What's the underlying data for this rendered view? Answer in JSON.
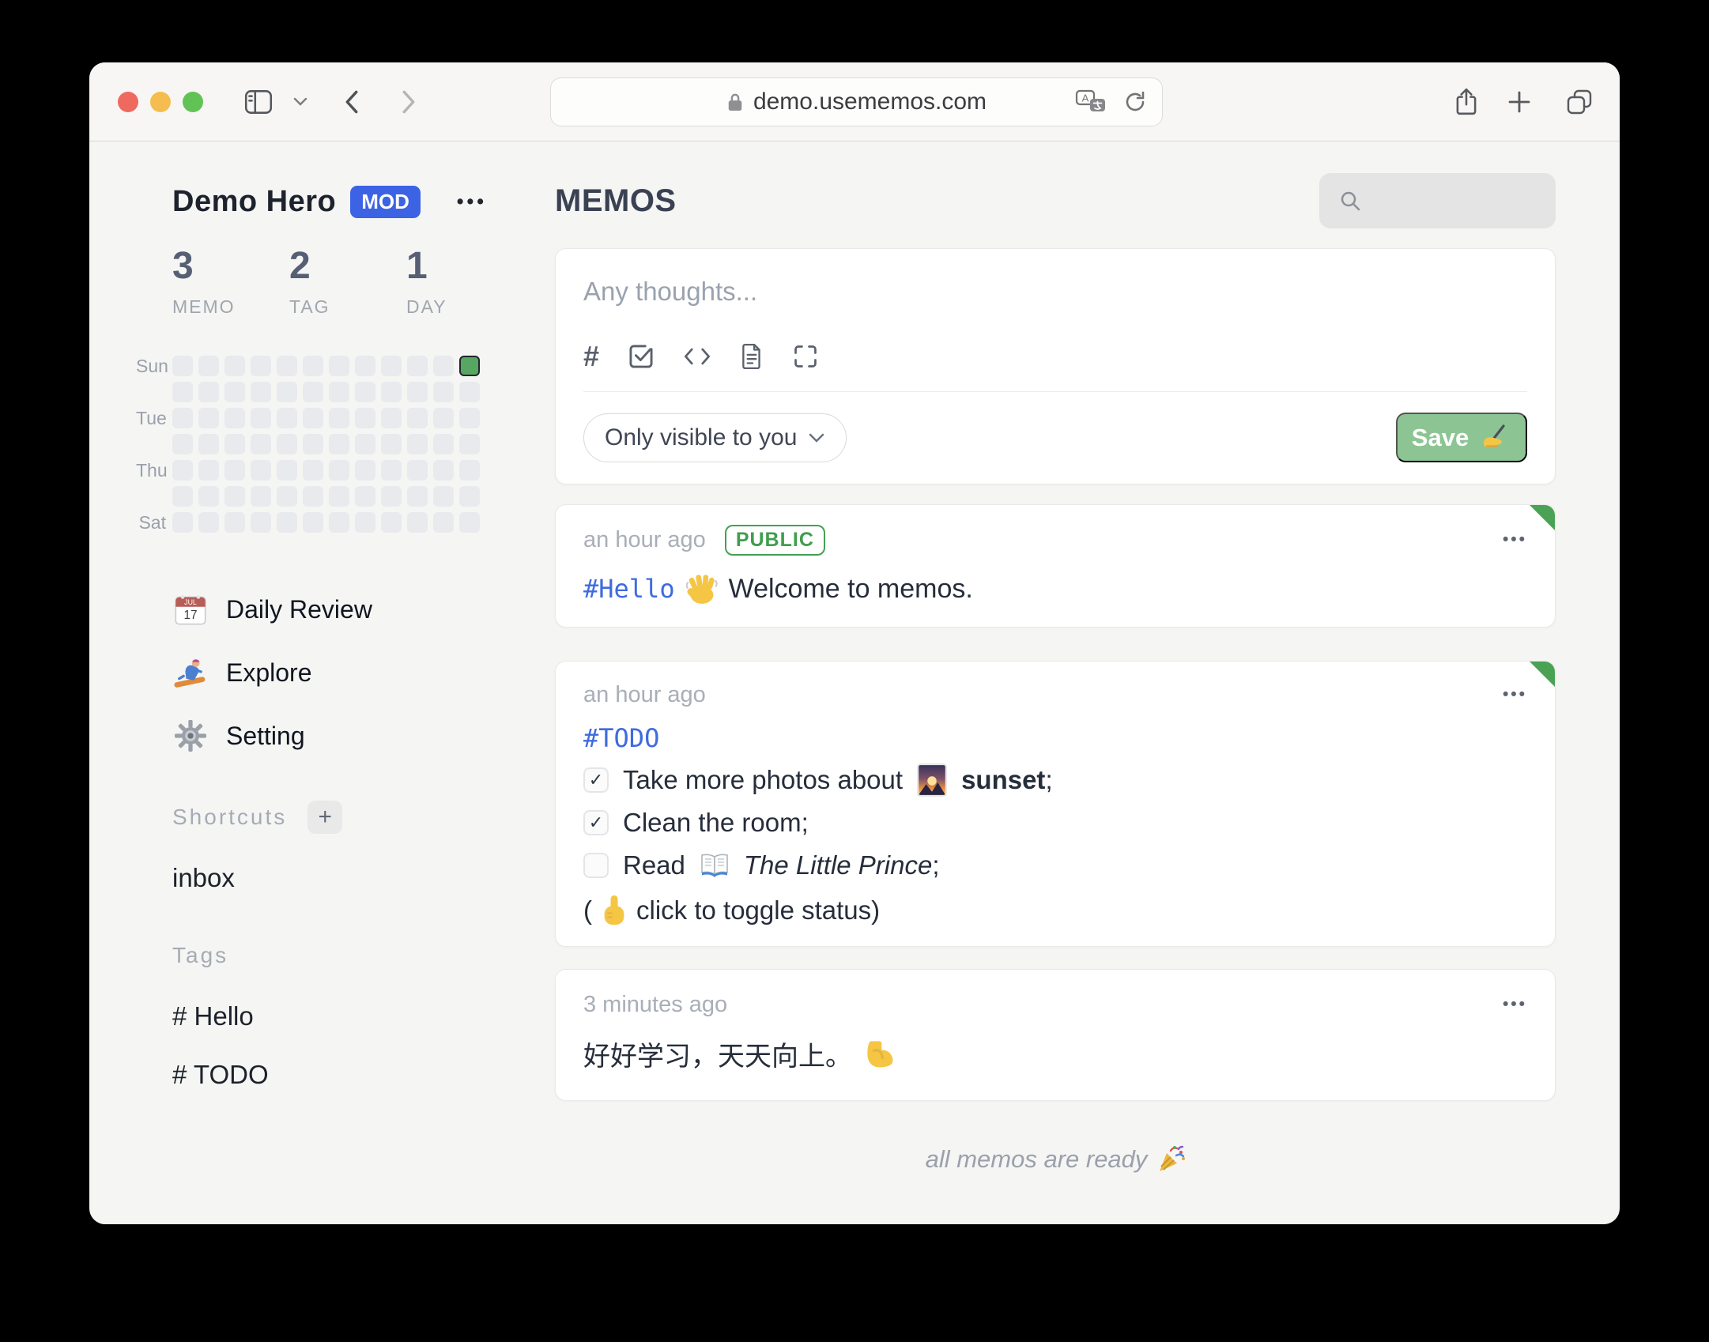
{
  "browser": {
    "url": "demo.usememos.com"
  },
  "sidebar": {
    "user": {
      "name": "Demo Hero",
      "badge": "MOD"
    },
    "menu_dots": "•••",
    "stats": [
      {
        "value": "3",
        "label": "MEMO"
      },
      {
        "value": "2",
        "label": "TAG"
      },
      {
        "value": "1",
        "label": "DAY"
      }
    ],
    "heatmap": {
      "weeks": 12,
      "days": 7,
      "row_labels": [
        "Sun",
        "",
        "Tue",
        "",
        "Thu",
        "",
        "Sat"
      ],
      "active": {
        "week": 12,
        "day": 1
      },
      "cell_color": "#e9eaee",
      "active_color": "#57a763"
    },
    "nav": [
      {
        "icon": "calendar-emoji",
        "label": "Daily Review"
      },
      {
        "icon": "snowboarder-emoji",
        "label": "Explore"
      },
      {
        "icon": "gear-emoji",
        "label": "Setting"
      }
    ],
    "shortcuts": {
      "title": "Shortcuts",
      "add_label": "+",
      "items": [
        "inbox"
      ]
    },
    "tags": {
      "title": "Tags",
      "items": [
        "# Hello",
        "# TODO"
      ]
    }
  },
  "main": {
    "title": "MEMOS",
    "menu_dots": "•••",
    "editor": {
      "placeholder": "Any thoughts...",
      "visibility_label": "Only visible to you",
      "save_label": "Save",
      "save_emoji": "✍️"
    },
    "memos": [
      {
        "time": "an hour ago",
        "visibility_badge": "PUBLIC",
        "tag": "#Hello",
        "emoji": "👋",
        "text": "Welcome to memos."
      },
      {
        "time": "an hour ago",
        "tag": "#TODO",
        "tasks": [
          {
            "checked": true,
            "check_glyph": "✓",
            "before": "Take more photos about",
            "image_emoji": "🌄",
            "bold": "sunset",
            "after": ";"
          },
          {
            "checked": true,
            "check_glyph": "✓",
            "text": "Clean the room;"
          },
          {
            "checked": false,
            "before": "Read",
            "book_emoji": "📖",
            "italic": "The Little Prince",
            "after": ";"
          }
        ],
        "hint": {
          "open": "(",
          "emoji": "👆",
          "text": "click to toggle status)"
        }
      },
      {
        "time": "3 minutes ago",
        "text": "好好学习，天天向上。",
        "emoji": "💪"
      }
    ],
    "footer": {
      "text": "all memos are ready",
      "emoji": "🎉"
    }
  },
  "colors": {
    "badge_blue": "#3c63e4",
    "tag_blue": "#3f6be0",
    "public_green": "#3f9e4d",
    "save_green": "#8dc493",
    "corner_green": "#4aa255",
    "heatmap_green": "#57a763"
  }
}
